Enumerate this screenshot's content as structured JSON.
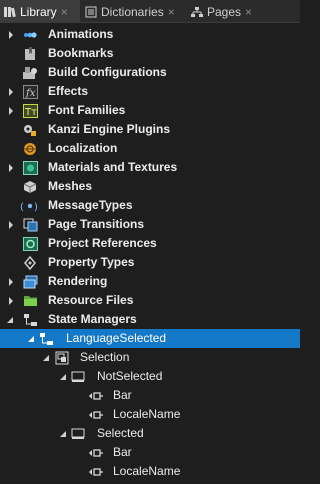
{
  "tabs": [
    {
      "label": "Library",
      "close": "×",
      "icon": "library-icon",
      "active": true
    },
    {
      "label": "Dictionaries",
      "close": "×",
      "icon": "dictionaries-icon",
      "active": false
    },
    {
      "label": "Pages",
      "close": "×",
      "icon": "pages-icon",
      "active": false
    }
  ],
  "tree": [
    {
      "label": "Animations",
      "icon": "animations-icon",
      "expander": "collapsed"
    },
    {
      "label": "Bookmarks",
      "icon": "bookmarks-icon",
      "expander": "none"
    },
    {
      "label": "Build Configurations",
      "icon": "build-configurations-icon",
      "expander": "none"
    },
    {
      "label": "Effects",
      "icon": "effects-icon",
      "expander": "collapsed"
    },
    {
      "label": "Font Families",
      "icon": "font-families-icon",
      "expander": "collapsed"
    },
    {
      "label": "Kanzi Engine Plugins",
      "icon": "plugins-icon",
      "expander": "none"
    },
    {
      "label": "Localization",
      "icon": "localization-icon",
      "expander": "none"
    },
    {
      "label": "Materials and Textures",
      "icon": "materials-icon",
      "expander": "collapsed"
    },
    {
      "label": "Meshes",
      "icon": "meshes-icon",
      "expander": "none"
    },
    {
      "label": "MessageTypes",
      "icon": "message-types-icon",
      "expander": "none"
    },
    {
      "label": "Page Transitions",
      "icon": "page-transitions-icon",
      "expander": "collapsed"
    },
    {
      "label": "Project References",
      "icon": "project-references-icon",
      "expander": "none"
    },
    {
      "label": "Property Types",
      "icon": "property-types-icon",
      "expander": "none"
    },
    {
      "label": "Rendering",
      "icon": "rendering-icon",
      "expander": "collapsed"
    },
    {
      "label": "Resource Files",
      "icon": "resource-files-icon",
      "expander": "collapsed"
    },
    {
      "label": "State Managers",
      "icon": "state-managers-icon",
      "expander": "expanded"
    },
    {
      "label": "LanguageSelected",
      "icon": "state-manager-icon",
      "expander": "expanded",
      "selected": true
    },
    {
      "label": "Selection",
      "icon": "state-group-icon",
      "expander": "expanded"
    },
    {
      "label": "NotSelected",
      "icon": "state-icon",
      "expander": "expanded"
    },
    {
      "label": "Bar",
      "icon": "property-icon",
      "expander": "none"
    },
    {
      "label": "LocaleName",
      "icon": "property-icon",
      "expander": "none"
    },
    {
      "label": "Selected",
      "icon": "state-icon",
      "expander": "expanded"
    },
    {
      "label": "Bar",
      "icon": "property-icon",
      "expander": "none"
    },
    {
      "label": "LocaleName",
      "icon": "property-icon",
      "expander": "none"
    }
  ],
  "colors": {
    "background": "#1e1e1e",
    "selection": "#1478c8",
    "text": "#ececec"
  }
}
